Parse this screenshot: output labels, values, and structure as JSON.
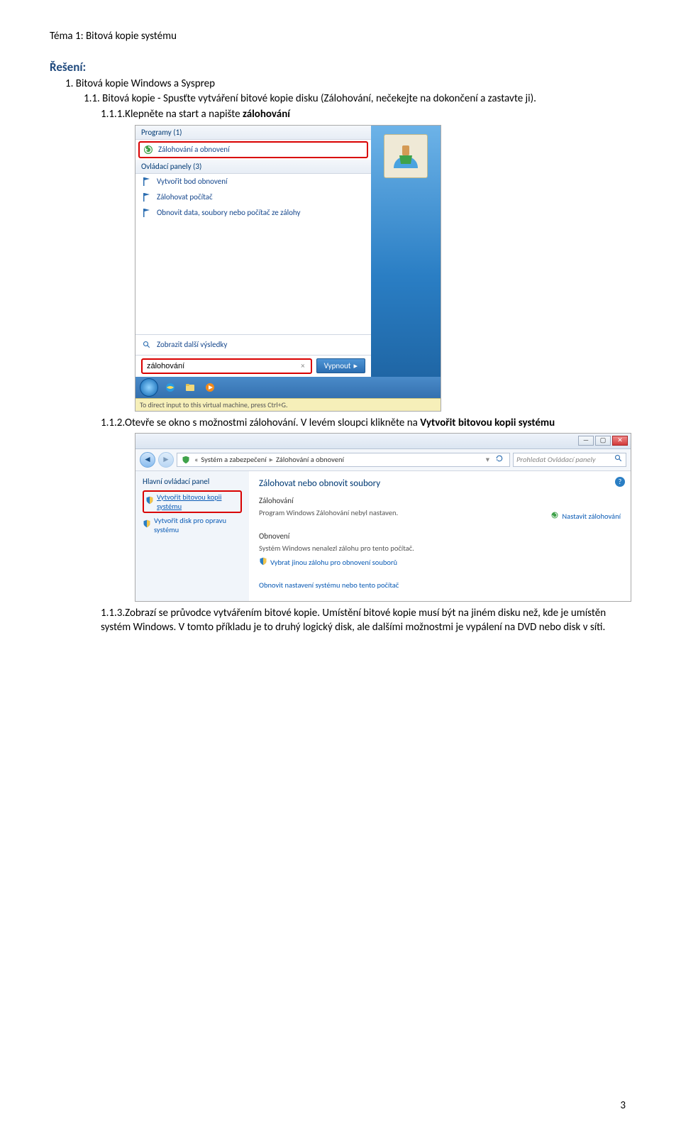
{
  "page": {
    "header": "Téma 1: Bitová kopie systému",
    "heading": "Řešení:",
    "line1": "1.   Bitová kopie Windows a Sysprep",
    "line2_a": "1.1. Bitová kopie - Spusťte vytváření bitové kopie disku (Zálohování, nečekejte na dokončení a zastavte ji).",
    "line3_pre": "1.1.1.Klepněte na start a napište ",
    "line3_bold": "zálohování",
    "line4_pre": "1.1.2.Otevře se okno s možnostmi zálohování. V levém sloupci klikněte na ",
    "line4_bold": "Vytvořit bitovou kopii systému",
    "line5": "1.1.3.Zobrazí se průvodce vytvářením bitové kopie. Umístění bitové kopie musí být na jiném disku než, kde je umístěn systém Windows. V tomto příkladu je to druhý logický disk, ale dalšími možnostmi je vypálení na DVD nebo disk v síti.",
    "page_number": "3"
  },
  "shot1": {
    "programs_label": "Programy (1)",
    "program_item": "Zálohování a obnovení",
    "panels_label": "Ovládací panely (3)",
    "panel_items": [
      "Vytvořit bod obnovení",
      "Zálohovat počítač",
      "Obnovit data, soubory nebo počítač ze zálohy"
    ],
    "show_more": "Zobrazit další výsledky",
    "search_value": "zálohování",
    "shutdown": "Vypnout",
    "vm_hint": "To direct input to this virtual machine, press Ctrl+G."
  },
  "shot2": {
    "breadcrumb_parts": [
      "«",
      "Systém a zabezpečení",
      "Zálohování a obnovení"
    ],
    "search_placeholder": "Prohledat Ovládací panely",
    "side_title": "Hlavní ovládací panel",
    "side_links": [
      "Vytvořit bitovou kopii systému",
      "Vytvořit disk pro opravu systému"
    ],
    "main_title": "Zálohovat nebo obnovit soubory",
    "sec_backup": "Zálohování",
    "backup_text": "Program Windows Zálohování nebyl nastaven.",
    "nastavit": "Nastavit zálohování",
    "sec_restore": "Obnovení",
    "restore_text": "Systém Windows nenalezl zálohu pro tento počítač.",
    "restore_action": "Vybrat jinou zálohu pro obnovení souborů",
    "bottom_action": "Obnovit nastavení systému nebo tento počítač"
  }
}
